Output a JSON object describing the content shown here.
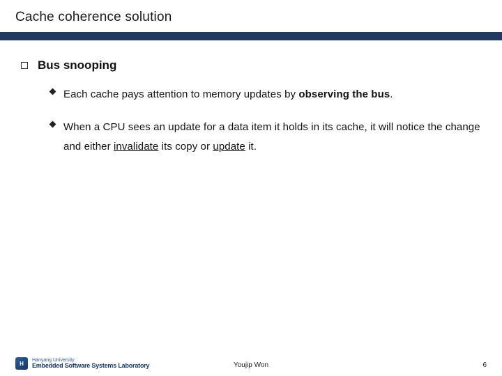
{
  "slide": {
    "title": "Cache coherence solution",
    "heading": "Bus snooping",
    "bullets": [
      {
        "pre": "Each cache pays attention to memory updates by ",
        "bold1": "observing the bus",
        "post": "."
      },
      {
        "line2_pre": "When a CPU sees an update for a data item it holds in its cache, it will notice the change and either ",
        "u1": "invalidate",
        "mid": " its copy or ",
        "u2": "update",
        "post2": " it."
      }
    ]
  },
  "footer": {
    "logo_small": "Hanyang University",
    "logo_main": "Embedded Software Systems Laboratory",
    "author": "Youjip Won",
    "page": "6"
  }
}
